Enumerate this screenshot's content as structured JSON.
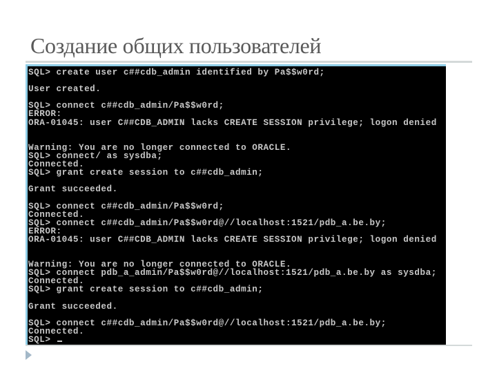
{
  "slide": {
    "title": "Создание общих пользователей",
    "bullet_icon": "triangle-right-icon"
  },
  "terminal": {
    "colors": {
      "background": "#000000",
      "text": "#c8c8c8",
      "frame": "#8fcde6"
    },
    "lines": [
      "SQL> create user c##cdb_admin identified by Pa$$w0rd;",
      "",
      "User created.",
      "",
      "SQL> connect c##cdb_admin/Pa$$w0rd;",
      "ERROR:",
      "ORA-01045: user C##CDB_ADMIN lacks CREATE SESSION privilege; logon denied",
      "",
      "",
      "Warning: You are no longer connected to ORACLE.",
      "SQL> connect/ as sysdba;",
      "Connected.",
      "SQL> grant create session to c##cdb_admin;",
      "",
      "Grant succeeded.",
      "",
      "SQL> connect c##cdb_admin/Pa$$w0rd;",
      "Connected.",
      "SQL> connect c##cdb_admin/Pa$$w0rd@//localhost:1521/pdb_a.be.by;",
      "ERROR:",
      "ORA-01045: user C##CDB_ADMIN lacks CREATE SESSION privilege; logon denied",
      "",
      "",
      "Warning: You are no longer connected to ORACLE.",
      "SQL> connect pdb_a_admin/Pa$$w0rd@//localhost:1521/pdb_a.be.by as sysdba;",
      "Connected.",
      "SQL> grant create session to c##cdb_admin;",
      "",
      "Grant succeeded.",
      "",
      "SQL> connect c##cdb_admin/Pa$$w0rd@//localhost:1521/pdb_a.be.by;",
      "Connected."
    ],
    "prompt": "SQL> "
  }
}
